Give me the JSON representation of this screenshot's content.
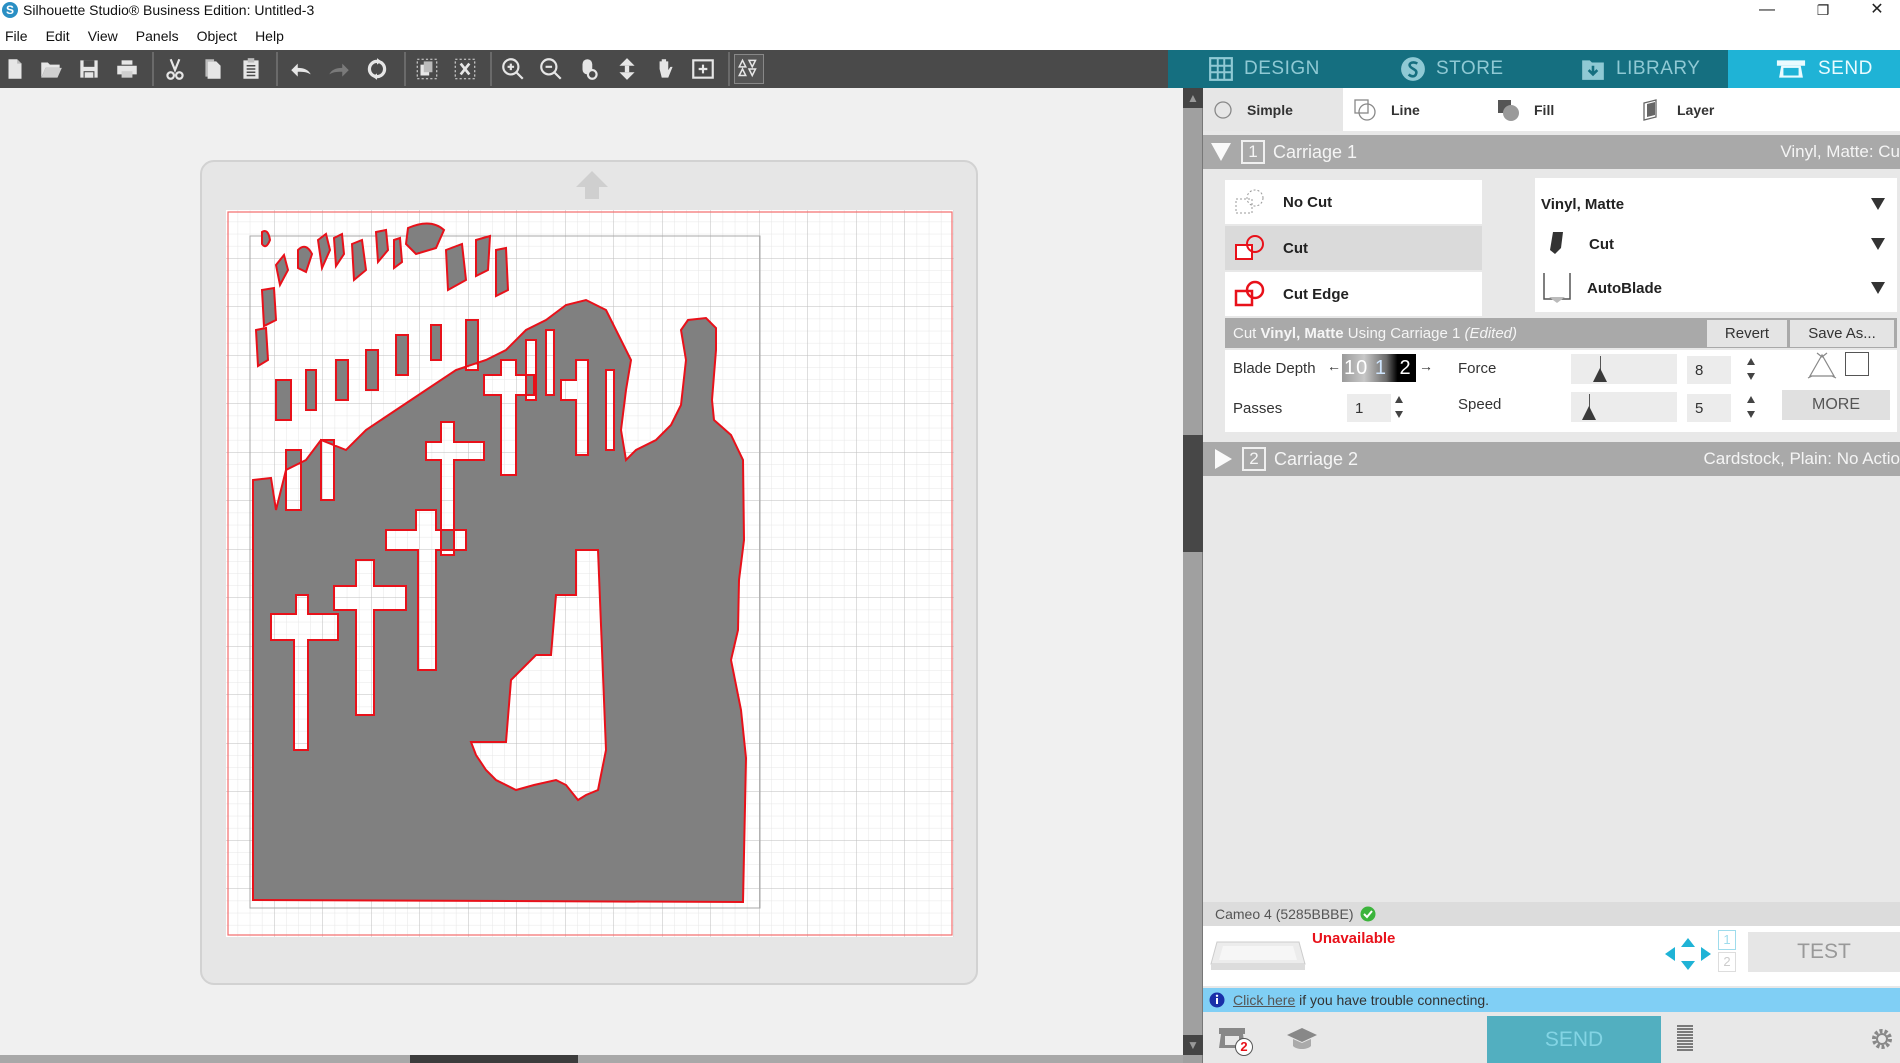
{
  "window": {
    "title": "Silhouette Studio® Business Edition: Untitled-3",
    "app_icon_glyph": "S",
    "controls": {
      "minimize": "—",
      "restore": "❐",
      "close": "✕"
    }
  },
  "menu": [
    "File",
    "Edit",
    "View",
    "Panels",
    "Object",
    "Help"
  ],
  "toolbar": {
    "groups": [
      [
        "new-document",
        "open",
        "save",
        "print"
      ],
      [
        "cut",
        "copy",
        "paste"
      ],
      [
        "undo",
        "redo",
        "redraw"
      ],
      [
        "group",
        "ungroup"
      ],
      [
        "zoom-in",
        "zoom-out",
        "zoom-select",
        "fit-to-page",
        "pan",
        "zoom-fit-box"
      ],
      [
        "fill-page-toggle"
      ]
    ]
  },
  "nav_tabs": [
    {
      "label": "DESIGN",
      "icon": "grid-icon",
      "active": false
    },
    {
      "label": "STORE",
      "icon": "silhouette-s-icon",
      "active": false
    },
    {
      "label": "LIBRARY",
      "icon": "library-download-icon",
      "active": false
    },
    {
      "label": "SEND",
      "icon": "cutter-icon",
      "active": true
    }
  ],
  "canvas": {
    "design": "Silhouette of a person standing among rows of crosses in a cemetery",
    "fill_color": "#808080",
    "cut_line_color": "#e8111a"
  },
  "send_panel": {
    "modes": [
      {
        "label": "Simple",
        "active": true
      },
      {
        "label": "Line",
        "active": false
      },
      {
        "label": "Fill",
        "active": false
      },
      {
        "label": "Layer",
        "active": false
      }
    ],
    "carriage1": {
      "number": "1",
      "name": "Carriage 1",
      "summary": "Vinyl, Matte: Cu",
      "expanded": true,
      "cut_options": [
        {
          "label": "No Cut",
          "active": false
        },
        {
          "label": "Cut",
          "active": true
        },
        {
          "label": "Cut Edge",
          "active": false
        }
      ],
      "material": "Vinyl, Matte",
      "action": "Cut",
      "tool": "AutoBlade",
      "status_prefix": "Cut ",
      "status_material": "Vinyl, Matte",
      "status_middle": " Using Carriage 1 ",
      "status_edited": "(Edited)",
      "revert_label": "Revert",
      "save_as_label": "Save As...",
      "settings": {
        "blade_depth_label": "Blade Depth",
        "blade_depth_ticks": [
          "10",
          "1",
          "2"
        ],
        "blade_depth_value": "1",
        "force_label": "Force",
        "force_value": "8",
        "force_fraction": 0.27,
        "passes_label": "Passes",
        "passes_value": "1",
        "speed_label": "Speed",
        "speed_value": "5",
        "speed_fraction": 0.17,
        "more_label": "MORE"
      }
    },
    "carriage2": {
      "number": "2",
      "name": "Carriage 2",
      "summary": "Cardstock, Plain: No Actio",
      "expanded": false
    },
    "device": {
      "name": "Cameo 4 (5285BBBE)",
      "connected_check": true,
      "status": "Unavailable",
      "carriage_nums": [
        "1",
        "2"
      ],
      "test_label": "TEST"
    },
    "info": {
      "link": "Click here",
      "text": " if you have trouble connecting."
    },
    "bottom": {
      "send_label": "SEND",
      "badge_count": "2"
    }
  }
}
